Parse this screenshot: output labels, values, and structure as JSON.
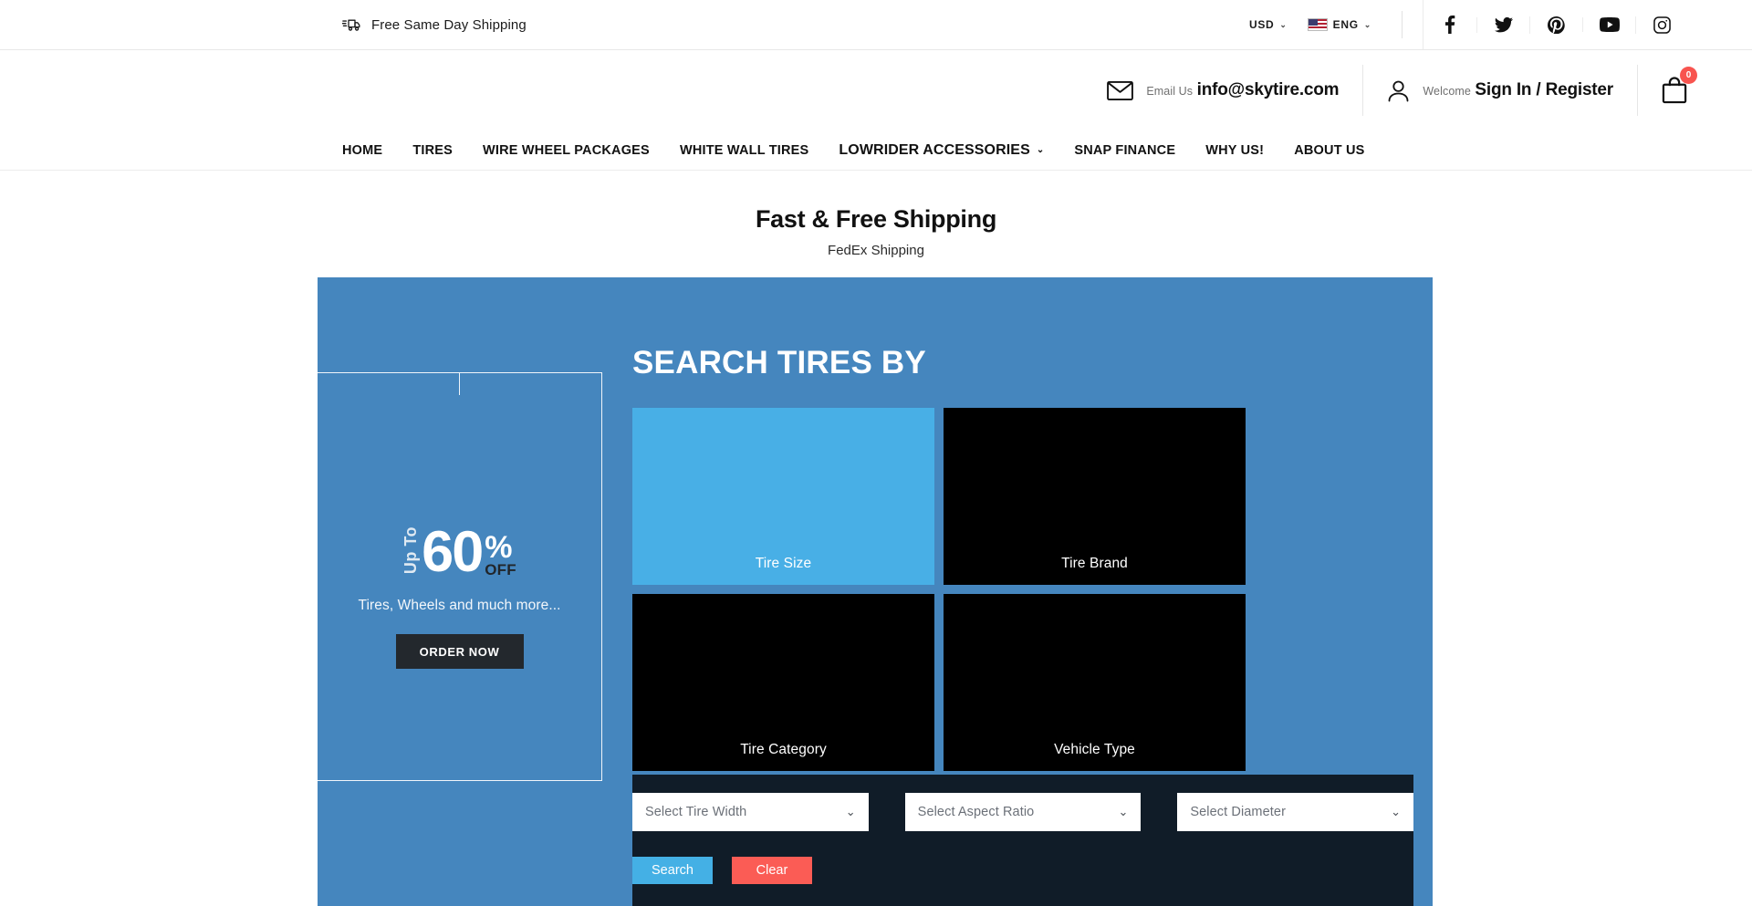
{
  "topbar": {
    "shipping_text": "Free Same Day Shipping",
    "truck_icon": "delivery-truck-icon",
    "currency": "USD",
    "language": "ENG",
    "caret": "⌄",
    "social": [
      {
        "name": "facebook-icon",
        "label": "Facebook"
      },
      {
        "name": "twitter-icon",
        "label": "Twitter"
      },
      {
        "name": "pinterest-icon",
        "label": "Pinterest"
      },
      {
        "name": "youtube-icon",
        "label": "YouTube"
      },
      {
        "name": "instagram-icon",
        "label": "Instagram"
      }
    ]
  },
  "header": {
    "email_label": "Email Us",
    "email_value": "info@skytire.com",
    "account_label": "Welcome",
    "account_value": "Sign In / Register",
    "cart_count": "0"
  },
  "nav": {
    "items": [
      {
        "label": "HOME",
        "has_caret": false
      },
      {
        "label": "TIRES",
        "has_caret": false
      },
      {
        "label": "WIRE WHEEL PACKAGES",
        "has_caret": false
      },
      {
        "label": "WHITE WALL TIRES",
        "has_caret": false
      },
      {
        "label": "LOWRIDER ACCESSORIES",
        "has_caret": true
      },
      {
        "label": "SNAP FINANCE",
        "has_caret": false
      },
      {
        "label": "WHY US!",
        "has_caret": false
      },
      {
        "label": "ABOUT US",
        "has_caret": false
      }
    ],
    "caret": "⌄"
  },
  "shipping_banner": {
    "title": "Fast & Free Shipping",
    "subtitle": "FedEx Shipping"
  },
  "promo": {
    "up_to": "Up To",
    "number": "60",
    "percent": "%",
    "off": "OFF",
    "tagline": "Tires, Wheels and much more...",
    "cta": "ORDER NOW"
  },
  "search": {
    "heading": "SEARCH TIRES BY",
    "tiles": [
      {
        "label": "Tire Size",
        "style": "light"
      },
      {
        "label": "Tire Brand",
        "style": "dark"
      },
      {
        "label": "Tire Category",
        "style": "dark"
      },
      {
        "label": "Vehicle Type",
        "style": "dark"
      }
    ],
    "selects": [
      {
        "placeholder": "Select Tire Width",
        "value": ""
      },
      {
        "placeholder": "Select Aspect Ratio",
        "value": ""
      },
      {
        "placeholder": "Select Diameter",
        "value": ""
      }
    ],
    "caret": "⌄",
    "search_button": "Search",
    "clear_button": "Clear"
  },
  "colors": {
    "section_blue": "#4586be",
    "tile_light_blue": "#48afe6",
    "tile_dark": "#000000",
    "panel_dark": "#101c28",
    "search_btn": "#44b0e5",
    "clear_btn": "#fb5c55",
    "badge_red": "#f8544f",
    "order_btn": "#23282d"
  }
}
